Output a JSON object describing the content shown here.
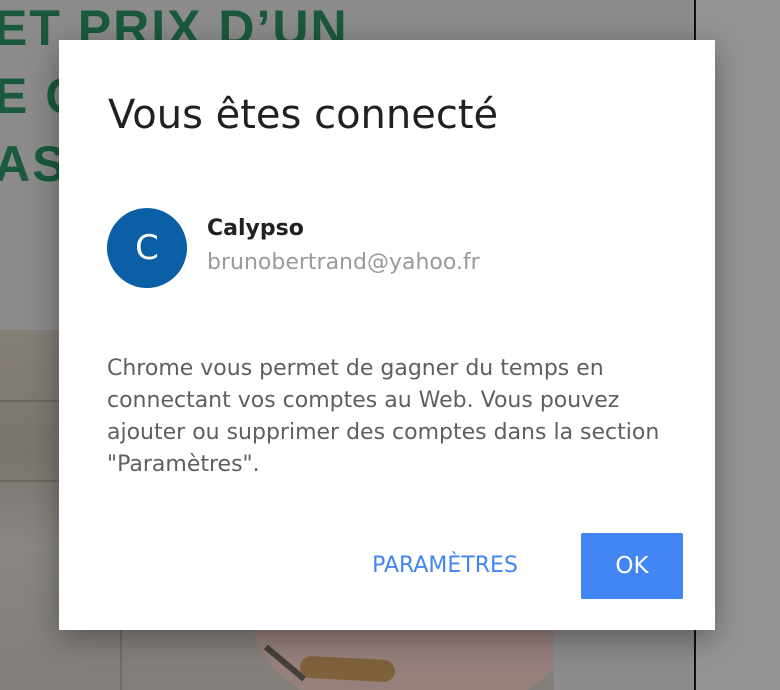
{
  "background": {
    "heading_lines": [
      "ET PRIX D’UN",
      "E C",
      "ASS"
    ]
  },
  "dialog": {
    "title": "Vous êtes connecté",
    "account": {
      "avatar_initial": "C",
      "name": "Calypso",
      "email": "brunobertrand@yahoo.fr"
    },
    "body": "Chrome vous permet de gagner du temps en connectant vos comptes au Web. Vous pouvez ajouter ou supprimer des comptes dans la section \"Paramètres\".",
    "buttons": {
      "settings_label": "PARAMÈTRES",
      "ok_label": "OK"
    }
  },
  "colors": {
    "accent": "#4285f4",
    "avatar": "#0b5fa5",
    "heading_green": "#2a8c5f"
  }
}
